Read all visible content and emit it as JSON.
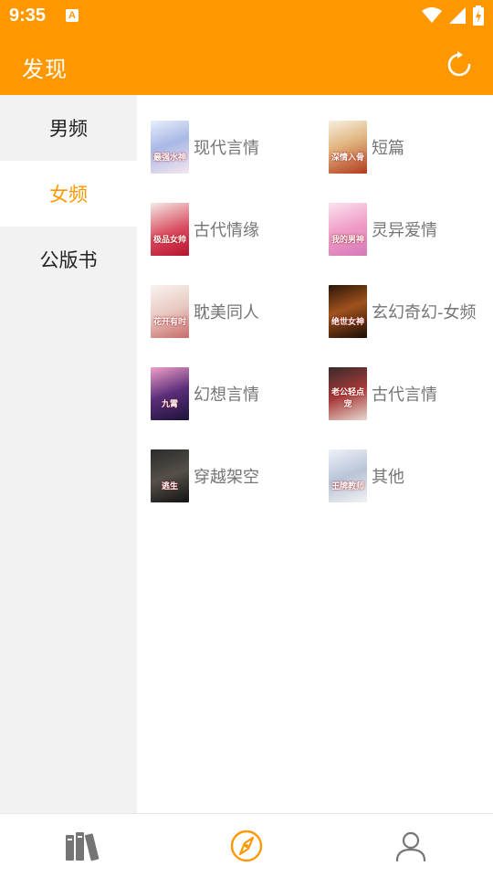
{
  "status": {
    "time": "9:35",
    "notification_icon": "A"
  },
  "header": {
    "title": "发现",
    "refresh_icon": "refresh-icon"
  },
  "sidebar": {
    "items": [
      {
        "label": "男频"
      },
      {
        "label": "女频"
      },
      {
        "label": "公版书"
      }
    ],
    "active_index": 1
  },
  "categories": [
    {
      "label": "现代言情",
      "cover_title": "最强水神"
    },
    {
      "label": "短篇",
      "cover_title": "深情入骨"
    },
    {
      "label": "古代情缘",
      "cover_title": "极品女帅"
    },
    {
      "label": "灵异爱情",
      "cover_title": "我的男神"
    },
    {
      "label": "耽美同人",
      "cover_title": "花开有时"
    },
    {
      "label": "玄幻奇幻-女频",
      "cover_title": "绝世女神"
    },
    {
      "label": "幻想言情",
      "cover_title": "九霄"
    },
    {
      "label": "古代言情",
      "cover_title": "老公轻点宠"
    },
    {
      "label": "穿越架空",
      "cover_title": "逃生"
    },
    {
      "label": "其他",
      "cover_title": "王牌教师"
    }
  ],
  "bottom_nav": [
    {
      "icon": "bookshelf-icon"
    },
    {
      "icon": "compass-icon"
    },
    {
      "icon": "profile-icon"
    }
  ],
  "colors": {
    "accent": "#FF9800",
    "sidebar_bg": "#F2F2F2",
    "label_gray": "#757575"
  }
}
